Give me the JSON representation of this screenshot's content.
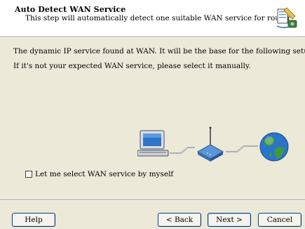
{
  "header": {
    "title": "Auto Detect WAN Service",
    "subtitle": "This step will automatically detect one suitable WAN service for router"
  },
  "body": {
    "line1": "The dynamic IP service found at WAN. It will be the base for the following setup.",
    "line2": "If it's not your expected WAN service, please select it manually."
  },
  "checkbox": {
    "label": "Let me select WAN service by myself",
    "checked": false
  },
  "buttons": {
    "help": "Help",
    "back": "< Back",
    "next": "Next >",
    "cancel": "Cancel"
  },
  "icons": {
    "header_icon": "setup-wizard-icon",
    "computer": "computer-icon",
    "router": "router-icon",
    "globe": "globe-icon"
  },
  "colors": {
    "background": "#ece9d8",
    "header_bg": "#ffffff",
    "button_border": "#003c74"
  }
}
